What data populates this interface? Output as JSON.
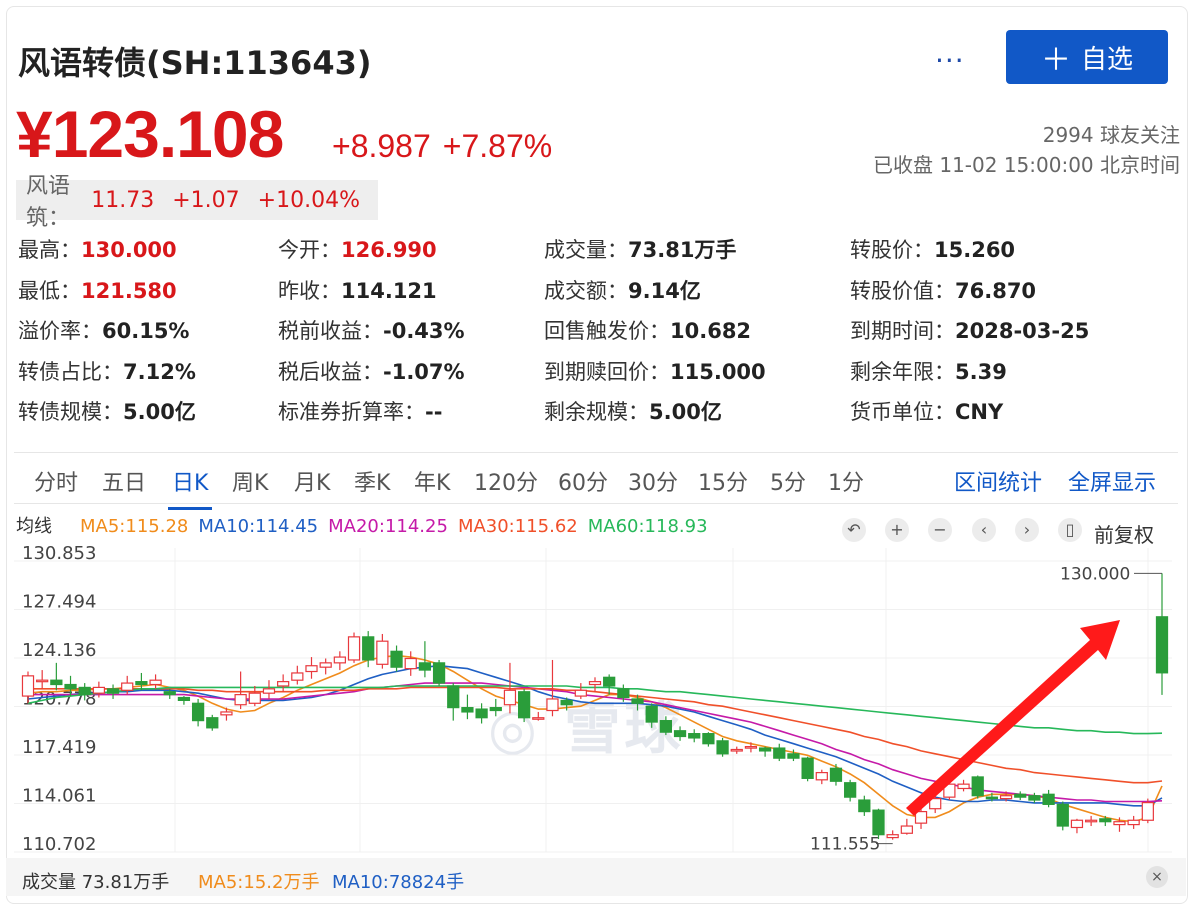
{
  "header": {
    "title": "风语转债(SH:113643)",
    "more": "···",
    "add_label": "自选",
    "add_plus": "＋"
  },
  "quote": {
    "price": "¥123.108",
    "change": "+8.987",
    "change_pct": "+7.87%",
    "followers": "2994 球友关注",
    "status": "已收盘 11-02 15:00:00 北京时间"
  },
  "underlying": {
    "label": "风语筑：",
    "price": "11.73",
    "change": "+1.07",
    "change_pct": "+10.04%"
  },
  "stats": [
    {
      "k": "最高：",
      "v": "130.000",
      "red": true
    },
    {
      "k": "今开：",
      "v": "126.990",
      "red": true
    },
    {
      "k": "成交量：",
      "v": "73.81万手"
    },
    {
      "k": "转股价：",
      "v": "15.260"
    },
    {
      "k": "最低：",
      "v": "121.580",
      "red": true
    },
    {
      "k": "昨收：",
      "v": "114.121"
    },
    {
      "k": "成交额：",
      "v": "9.14亿"
    },
    {
      "k": "转股价值：",
      "v": "76.870"
    },
    {
      "k": "溢价率：",
      "v": "60.15%"
    },
    {
      "k": "税前收益：",
      "v": "-0.43%"
    },
    {
      "k": "回售触发价：",
      "v": "10.682"
    },
    {
      "k": "到期时间：",
      "v": "2028-03-25"
    },
    {
      "k": "转债占比：",
      "v": "7.12%"
    },
    {
      "k": "税后收益：",
      "v": "-1.07%"
    },
    {
      "k": "到期赎回价：",
      "v": "115.000"
    },
    {
      "k": "剩余年限：",
      "v": "5.39"
    },
    {
      "k": "转债规模：",
      "v": "5.00亿"
    },
    {
      "k": "标准券折算率：",
      "v": "--"
    },
    {
      "k": "剩余规模：",
      "v": "5.00亿"
    },
    {
      "k": "货币单位：",
      "v": "CNY"
    }
  ],
  "tabs": [
    "分时",
    "五日",
    "日K",
    "周K",
    "月K",
    "季K",
    "年K",
    "120分",
    "60分",
    "30分",
    "15分",
    "5分",
    "1分"
  ],
  "active_tab": "日K",
  "tab_actions": [
    "区间统计",
    "全屏显示"
  ],
  "ma_legend": {
    "label": "均线",
    "items": [
      {
        "text": "MA5:115.28",
        "color": "#f08c1c"
      },
      {
        "text": "MA10:114.45",
        "color": "#1f5fc4"
      },
      {
        "text": "MA20:114.25",
        "color": "#c51aa8"
      },
      {
        "text": "MA30:115.62",
        "color": "#f0502a"
      },
      {
        "text": "MA60:118.93",
        "color": "#27b85a"
      }
    ]
  },
  "chart_tools": {
    "icons": [
      "undo-icon",
      "zoom-in-icon",
      "zoom-out-icon",
      "chevron-left-icon",
      "chevron-right-icon",
      "candle-icon"
    ],
    "glyphs": [
      "↶",
      "+",
      "−",
      "‹",
      "›",
      "▯"
    ],
    "adjust": "前复权"
  },
  "volume_legend": {
    "label": "成交量 73.81万手",
    "ma5": "MA5:15.2万手",
    "ma10": "MA10:78824手",
    "close": "×"
  },
  "chart_data": {
    "type": "candlestick",
    "y_ticks": [
      "130.853",
      "127.494",
      "124.136",
      "120.778",
      "117.419",
      "114.061",
      "110.702"
    ],
    "ylim": [
      110.702,
      130.853
    ],
    "high_label": "130.000",
    "low_label": "111.555",
    "up_color": "#e8383d",
    "down_color": "#2a9d3a",
    "candles": [
      [
        121.5,
        122.9,
        121.0,
        123.2
      ],
      [
        122.5,
        122.6,
        122.0,
        123.3
      ],
      [
        122.6,
        122.3,
        121.9,
        123.8
      ],
      [
        122.3,
        122.0,
        121.5,
        122.9
      ],
      [
        122.1,
        121.6,
        121.2,
        122.4
      ],
      [
        121.7,
        122.1,
        121.4,
        122.5
      ],
      [
        122.0,
        121.7,
        121.3,
        122.3
      ],
      [
        121.9,
        122.4,
        121.6,
        122.9
      ],
      [
        122.5,
        122.3,
        121.9,
        123.1
      ],
      [
        122.3,
        122.6,
        122.0,
        123.0
      ],
      [
        121.8,
        121.6,
        121.3,
        122.0
      ],
      [
        121.4,
        121.2,
        120.9,
        121.5
      ],
      [
        121.0,
        119.8,
        119.4,
        121.3
      ],
      [
        120.0,
        119.3,
        119.1,
        120.2
      ],
      [
        120.2,
        120.4,
        119.8,
        120.7
      ],
      [
        120.9,
        121.6,
        120.6,
        123.2
      ],
      [
        121.0,
        121.7,
        120.8,
        122.2
      ],
      [
        121.7,
        122.0,
        121.3,
        122.6
      ],
      [
        122.2,
        122.5,
        121.8,
        123.0
      ],
      [
        122.6,
        123.1,
        122.3,
        123.6
      ],
      [
        123.2,
        123.6,
        122.7,
        124.2
      ],
      [
        123.5,
        123.8,
        123.0,
        124.1
      ],
      [
        123.8,
        124.2,
        123.3,
        124.6
      ],
      [
        124.0,
        125.6,
        123.8,
        125.9
      ],
      [
        125.6,
        124.0,
        123.5,
        126.0
      ],
      [
        123.7,
        125.3,
        123.4,
        125.8
      ],
      [
        124.6,
        123.5,
        123.2,
        125.0
      ],
      [
        123.4,
        124.1,
        122.9,
        124.6
      ],
      [
        123.8,
        123.3,
        122.8,
        125.3
      ],
      [
        123.8,
        122.4,
        122.2,
        124.0
      ],
      [
        122.2,
        120.7,
        119.8,
        122.4
      ],
      [
        120.7,
        120.4,
        119.9,
        121.6
      ],
      [
        120.6,
        120.0,
        119.6,
        121.0
      ],
      [
        120.7,
        120.5,
        120.1,
        121.3
      ],
      [
        120.9,
        121.9,
        120.3,
        123.8
      ],
      [
        121.8,
        120.0,
        119.7,
        122.0
      ],
      [
        120.0,
        120.0,
        119.8,
        120.4
      ],
      [
        120.5,
        121.3,
        120.1,
        124.0
      ],
      [
        121.2,
        120.9,
        120.5,
        121.4
      ],
      [
        121.5,
        121.9,
        121.3,
        122.4
      ],
      [
        122.3,
        122.5,
        121.8,
        122.8
      ],
      [
        122.8,
        122.2,
        121.6,
        123.0
      ],
      [
        122.0,
        121.4,
        121.1,
        122.3
      ],
      [
        121.3,
        121.0,
        120.5,
        121.6
      ],
      [
        120.8,
        119.7,
        119.3,
        121.0
      ],
      [
        119.8,
        119.0,
        118.8,
        120.1
      ],
      [
        119.1,
        118.7,
        118.4,
        119.4
      ],
      [
        118.9,
        118.6,
        118.3,
        119.2
      ],
      [
        118.9,
        118.2,
        118.0,
        119.0
      ],
      [
        118.4,
        117.5,
        117.3,
        118.6
      ],
      [
        117.7,
        117.8,
        117.5,
        118.0
      ],
      [
        117.9,
        118.0,
        117.6,
        118.3
      ],
      [
        117.9,
        117.7,
        117.3,
        118.0
      ],
      [
        117.9,
        117.2,
        117.0,
        118.2
      ],
      [
        117.5,
        117.2,
        117.0,
        117.8
      ],
      [
        117.2,
        115.8,
        115.6,
        117.3
      ],
      [
        115.7,
        116.2,
        115.4,
        116.4
      ],
      [
        116.5,
        115.6,
        115.3,
        116.8
      ],
      [
        115.5,
        114.5,
        114.2,
        115.7
      ],
      [
        114.3,
        113.5,
        113.2,
        114.6
      ],
      [
        113.6,
        111.9,
        111.6,
        113.7
      ],
      [
        111.7,
        111.9,
        111.555,
        112.2
      ],
      [
        112.0,
        112.5,
        111.9,
        113.0
      ],
      [
        112.7,
        113.5,
        112.3,
        114.0
      ],
      [
        113.7,
        114.4,
        113.4,
        114.8
      ],
      [
        114.5,
        115.4,
        114.3,
        115.7
      ],
      [
        115.1,
        115.4,
        114.9,
        115.7
      ],
      [
        115.9,
        114.6,
        114.4,
        116.0
      ],
      [
        114.5,
        114.4,
        114.2,
        114.8
      ],
      [
        114.4,
        114.6,
        114.2,
        114.9
      ],
      [
        114.7,
        114.5,
        114.3,
        114.9
      ],
      [
        114.6,
        114.3,
        114.1,
        114.8
      ],
      [
        114.7,
        114.0,
        113.8,
        115.0
      ],
      [
        114.0,
        112.5,
        112.2,
        114.2
      ],
      [
        112.4,
        112.9,
        112.0,
        113.0
      ],
      [
        112.8,
        112.9,
        112.5,
        113.2
      ],
      [
        113.0,
        112.8,
        112.5,
        113.2
      ],
      [
        112.6,
        112.8,
        112.1,
        113.1
      ],
      [
        112.6,
        112.9,
        112.3,
        113.2
      ],
      [
        112.9,
        114.121,
        112.7,
        114.4
      ],
      [
        126.99,
        123.108,
        121.58,
        130.0
      ]
    ],
    "ma": [
      {
        "name": "MA5",
        "color": "#f08c1c",
        "values": [
          121.7,
          121.8,
          121.8,
          121.9,
          121.9,
          122.0,
          122.0,
          122.1,
          122.2,
          122.3,
          122.1,
          121.9,
          121.5,
          121.0,
          120.6,
          120.4,
          120.5,
          121.0,
          121.4,
          121.9,
          122.3,
          122.7,
          123.1,
          123.6,
          124.0,
          124.2,
          124.3,
          124.2,
          124.0,
          123.7,
          123.2,
          122.6,
          122.0,
          121.5,
          121.2,
          120.9,
          120.6,
          120.6,
          120.7,
          120.8,
          121.2,
          121.6,
          121.6,
          121.4,
          121.1,
          120.7,
          120.2,
          119.7,
          119.2,
          118.7,
          118.4,
          118.2,
          118.0,
          117.8,
          117.6,
          117.4,
          117.0,
          116.6,
          116.1,
          115.5,
          114.7,
          113.9,
          113.3,
          113.1,
          113.1,
          113.5,
          114.1,
          114.5,
          114.7,
          114.7,
          114.7,
          114.6,
          114.4,
          114.0,
          113.7,
          113.4,
          113.1,
          112.9,
          112.8,
          113.1,
          115.28
        ]
      },
      {
        "name": "MA10",
        "color": "#1f5fc4",
        "values": [
          121.3,
          121.4,
          121.5,
          121.6,
          121.7,
          121.7,
          121.8,
          121.8,
          121.9,
          121.9,
          121.9,
          121.8,
          121.7,
          121.5,
          121.3,
          121.2,
          121.2,
          121.2,
          121.2,
          121.3,
          121.4,
          121.6,
          121.9,
          122.3,
          122.7,
          123.0,
          123.2,
          123.4,
          123.5,
          123.6,
          123.5,
          123.4,
          123.1,
          122.8,
          122.5,
          122.2,
          121.8,
          121.5,
          121.3,
          121.1,
          121.0,
          121.0,
          121.0,
          121.0,
          120.9,
          120.8,
          120.6,
          120.4,
          120.1,
          119.8,
          119.5,
          119.2,
          118.8,
          118.5,
          118.2,
          117.9,
          117.6,
          117.3,
          116.9,
          116.5,
          116.1,
          115.6,
          115.2,
          114.8,
          114.5,
          114.3,
          114.2,
          114.2,
          114.3,
          114.3,
          114.2,
          114.1,
          114.1,
          114.1,
          114.1,
          114.1,
          114.1,
          114.0,
          113.9,
          113.9,
          114.45
        ]
      },
      {
        "name": "MA20",
        "color": "#c51aa8",
        "values": [
          121.6,
          121.6,
          121.6,
          121.6,
          121.6,
          121.6,
          121.6,
          121.6,
          121.6,
          121.6,
          121.6,
          121.6,
          121.5,
          121.4,
          121.3,
          121.3,
          121.3,
          121.3,
          121.3,
          121.4,
          121.5,
          121.6,
          121.7,
          121.8,
          122.0,
          122.1,
          122.2,
          122.3,
          122.4,
          122.4,
          122.4,
          122.4,
          122.4,
          122.3,
          122.2,
          122.1,
          122.0,
          121.9,
          121.8,
          121.6,
          121.5,
          121.4,
          121.3,
          121.2,
          121.1,
          120.9,
          120.7,
          120.5,
          120.3,
          120.1,
          119.9,
          119.7,
          119.4,
          119.1,
          118.8,
          118.5,
          118.2,
          117.8,
          117.5,
          117.1,
          116.8,
          116.4,
          116.1,
          115.8,
          115.6,
          115.4,
          115.2,
          115.0,
          114.9,
          114.8,
          114.7,
          114.6,
          114.5,
          114.4,
          114.3,
          114.3,
          114.2,
          114.2,
          114.2,
          114.2,
          114.25
        ]
      },
      {
        "name": "MA30",
        "color": "#f0502a",
        "values": [
          122.0,
          122.0,
          122.0,
          122.0,
          122.0,
          122.0,
          122.0,
          122.0,
          122.0,
          122.0,
          122.0,
          122.0,
          121.9,
          121.9,
          121.8,
          121.8,
          121.8,
          121.8,
          121.8,
          121.8,
          121.8,
          121.9,
          121.9,
          121.9,
          122.0,
          122.0,
          122.0,
          122.1,
          122.1,
          122.1,
          122.1,
          122.1,
          122.1,
          122.1,
          122.0,
          122.0,
          122.0,
          122.0,
          121.9,
          121.9,
          121.8,
          121.7,
          121.6,
          121.5,
          121.4,
          121.3,
          121.2,
          121.1,
          120.9,
          120.8,
          120.6,
          120.4,
          120.2,
          120.0,
          119.8,
          119.6,
          119.4,
          119.2,
          119.0,
          118.7,
          118.5,
          118.2,
          118.0,
          117.7,
          117.5,
          117.3,
          117.1,
          116.9,
          116.7,
          116.5,
          116.4,
          116.2,
          116.1,
          116.0,
          115.9,
          115.8,
          115.7,
          115.6,
          115.5,
          115.5,
          115.62
        ]
      },
      {
        "name": "MA60",
        "color": "#27b85a",
        "values": [
          121.0,
          121.2,
          121.4,
          121.5,
          121.6,
          121.7,
          121.8,
          121.9,
          122.0,
          122.0,
          122.1,
          122.1,
          122.1,
          122.1,
          122.1,
          122.1,
          122.1,
          122.1,
          122.1,
          122.1,
          122.1,
          122.1,
          122.1,
          122.1,
          122.1,
          122.1,
          122.2,
          122.2,
          122.2,
          122.2,
          122.2,
          122.2,
          122.2,
          122.2,
          122.2,
          122.2,
          122.2,
          122.2,
          122.2,
          122.1,
          122.1,
          122.1,
          122.0,
          122.0,
          121.9,
          121.8,
          121.8,
          121.7,
          121.6,
          121.5,
          121.4,
          121.3,
          121.2,
          121.1,
          121.0,
          120.9,
          120.8,
          120.7,
          120.6,
          120.5,
          120.4,
          120.3,
          120.2,
          120.1,
          120.0,
          119.9,
          119.8,
          119.7,
          119.6,
          119.5,
          119.4,
          119.3,
          119.3,
          119.2,
          119.1,
          119.1,
          119.0,
          119.0,
          118.9,
          118.9,
          118.93
        ]
      }
    ]
  }
}
